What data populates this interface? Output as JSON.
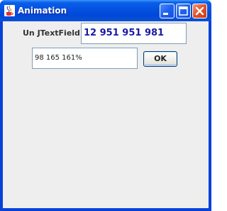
{
  "window": {
    "title": "Animation",
    "icon": "java-cup-icon",
    "title_bar_color": "#0553e2"
  },
  "form": {
    "textfield_label": "Un JTextField",
    "number_field_value": "12 951 951 981",
    "percent_field_value": "98 165 161%",
    "ok_button_label": "OK"
  },
  "colors": {
    "number_text": "#1a1aa6",
    "panel_background": "#eeeeee"
  }
}
